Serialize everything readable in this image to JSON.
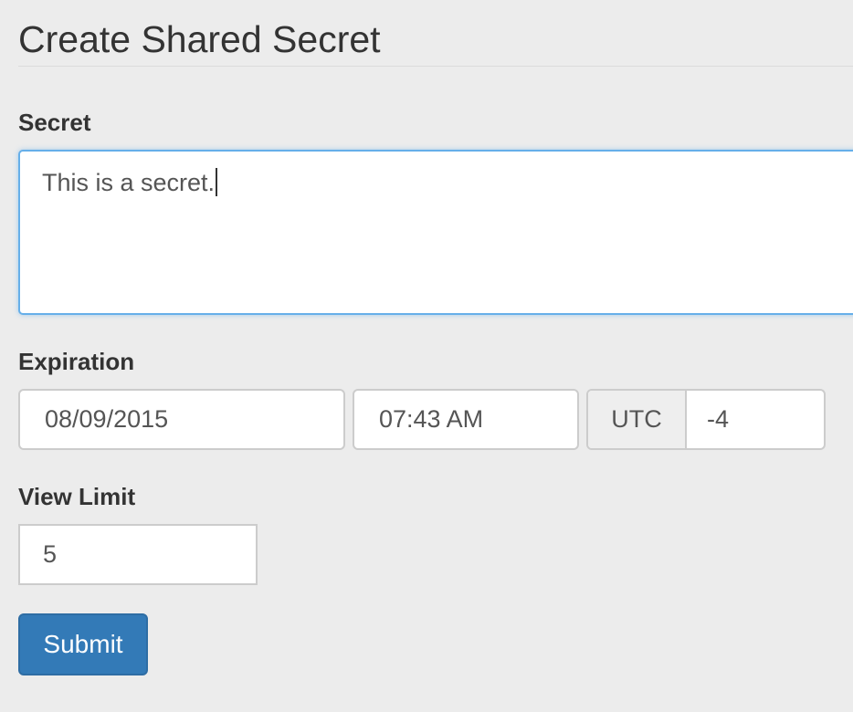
{
  "page": {
    "title": "Create Shared Secret"
  },
  "form": {
    "secret": {
      "label": "Secret",
      "value": "This is a secret."
    },
    "expiration": {
      "label": "Expiration",
      "date": "08/09/2015",
      "time": "07:43 AM",
      "timezone_label": "UTC",
      "timezone_offset": "-4"
    },
    "view_limit": {
      "label": "View Limit",
      "value": "5"
    },
    "submit_label": "Submit"
  },
  "colors": {
    "background": "#ececec",
    "focus_border": "#66afe9",
    "primary_button": "#337ab7",
    "text": "#333333",
    "input_border": "#cccccc"
  }
}
